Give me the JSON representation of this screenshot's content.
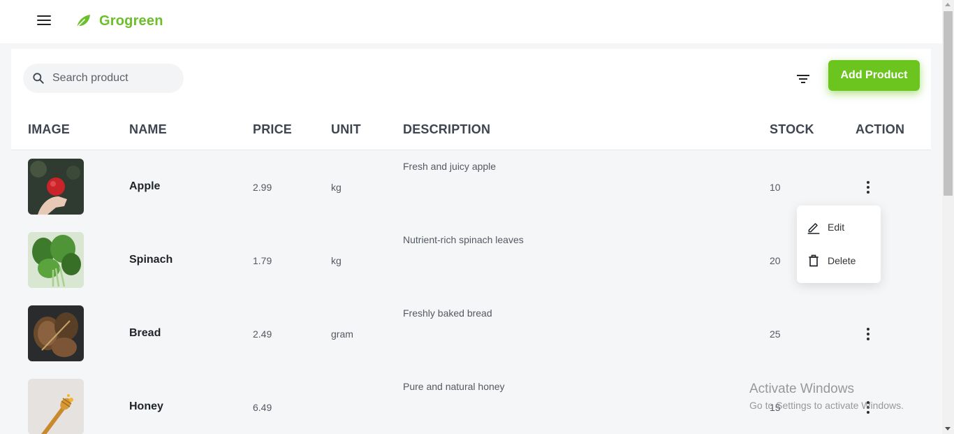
{
  "app": {
    "name": "Grogreen",
    "brand_color": "#6cbf2a",
    "icons": {
      "menu": "hamburger-icon",
      "logo": "leaf-icon"
    }
  },
  "toolbar": {
    "search_placeholder": "Search product",
    "search_value": "",
    "filter_icon": "filter-icon",
    "add_label": "Add Product",
    "add_color": "#6cc41e"
  },
  "table": {
    "columns": [
      "IMAGE",
      "NAME",
      "PRICE",
      "UNIT",
      "DESCRIPTION",
      "STOCK",
      "ACTION"
    ],
    "rows": [
      {
        "image": "apple-photo",
        "name": "Apple",
        "price": "2.99",
        "unit": "kg",
        "description": "Fresh and juicy apple",
        "stock": "10"
      },
      {
        "image": "spinach-photo",
        "name": "Spinach",
        "price": "1.79",
        "unit": "kg",
        "description": "Nutrient-rich spinach leaves",
        "stock": "20"
      },
      {
        "image": "bread-photo",
        "name": "Bread",
        "price": "2.49",
        "unit": "gram",
        "description": "Freshly baked bread",
        "stock": "25"
      },
      {
        "image": "honey-photo",
        "name": "Honey",
        "price": "6.49",
        "unit": "",
        "description": "Pure and natural honey",
        "stock": "15"
      }
    ]
  },
  "action_menu": {
    "open_for_row": "Apple",
    "items": [
      {
        "label": "Edit",
        "icon": "pencil-icon"
      },
      {
        "label": "Delete",
        "icon": "trash-icon"
      }
    ]
  },
  "watermark": {
    "title": "Activate Windows",
    "subtitle": "Go to Settings to activate Windows."
  }
}
